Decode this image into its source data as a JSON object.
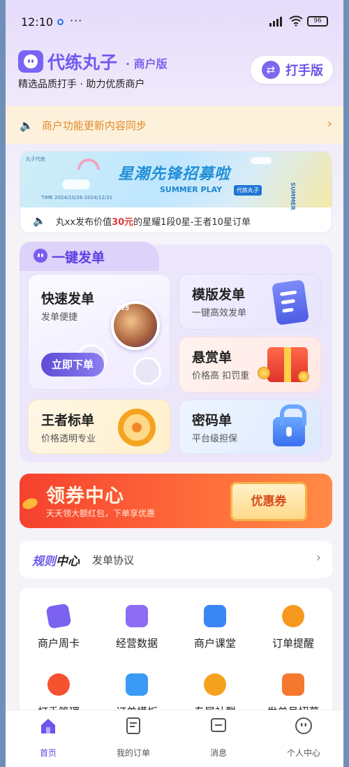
{
  "status_bar": {
    "time": "12:10",
    "more": "···",
    "battery": "96"
  },
  "header": {
    "app_name": "代练丸子",
    "badge": "· 商户版",
    "slogan": "精选品质打手 · 助力优质商户",
    "switch_label": "打手版"
  },
  "notice": {
    "text": "商户功能更新内容同步"
  },
  "banner": {
    "brand": "丸子代练",
    "title": "星潮先锋招募啦",
    "subtitle": "SUMMER PLAY",
    "tag": "代练丸子",
    "time": "TIME 2024/10/26-2024/12/31",
    "side": "SUMMER",
    "marquee_prefix": "丸xx发布价值",
    "marquee_price": "30元",
    "marquee_suffix": "的星耀1段0星-王者10星订单"
  },
  "order_panel": {
    "tab_label": "一键发单",
    "fast": {
      "title": "快速发单",
      "sub": "发单便捷",
      "button": "立即下单",
      "tag": "5v5"
    },
    "template": {
      "title": "模版发单",
      "sub": "一键高效发单"
    },
    "bounty": {
      "title": "悬赏单",
      "sub": "价格高 扣罚重"
    },
    "king": {
      "title": "王者标单",
      "sub": "价格透明专业"
    },
    "password": {
      "title": "密码单",
      "sub": "平台级担保"
    }
  },
  "coupon": {
    "title": "领券中心",
    "sub": "天天领大额红包，下单享优惠",
    "ticket": "优惠券"
  },
  "rules": {
    "title_a": "规则",
    "title_b": "中心",
    "link": "发单协议"
  },
  "tools": [
    {
      "label": "商户周卡",
      "icon": "ticket-icon",
      "color": "#7b62f0"
    },
    {
      "label": "经营数据",
      "icon": "chart-icon",
      "color": "#8c6cf2"
    },
    {
      "label": "商户课堂",
      "icon": "book-icon",
      "color": "#3b86f5"
    },
    {
      "label": "订单提醒",
      "icon": "clock-icon",
      "color": "#f59a1f"
    },
    {
      "label": "打手管理",
      "icon": "user-manage-icon",
      "color": "#f5532f"
    },
    {
      "label": "订单模板",
      "icon": "template-icon",
      "color": "#3b9af5"
    },
    {
      "label": "专属社群",
      "icon": "group-icon",
      "color": "#f5a21f"
    },
    {
      "label": "发单员招募",
      "icon": "recruit-icon",
      "color": "#f5782f"
    }
  ],
  "nav": [
    {
      "label": "首页",
      "icon": "home-icon"
    },
    {
      "label": "我的订单",
      "icon": "orders-icon"
    },
    {
      "label": "消息",
      "icon": "message-icon"
    },
    {
      "label": "个人中心",
      "icon": "profile-icon"
    }
  ],
  "colors": {
    "brand": "#6f5af0",
    "notice": "#e08a2a",
    "coupon": "#f5412e"
  }
}
